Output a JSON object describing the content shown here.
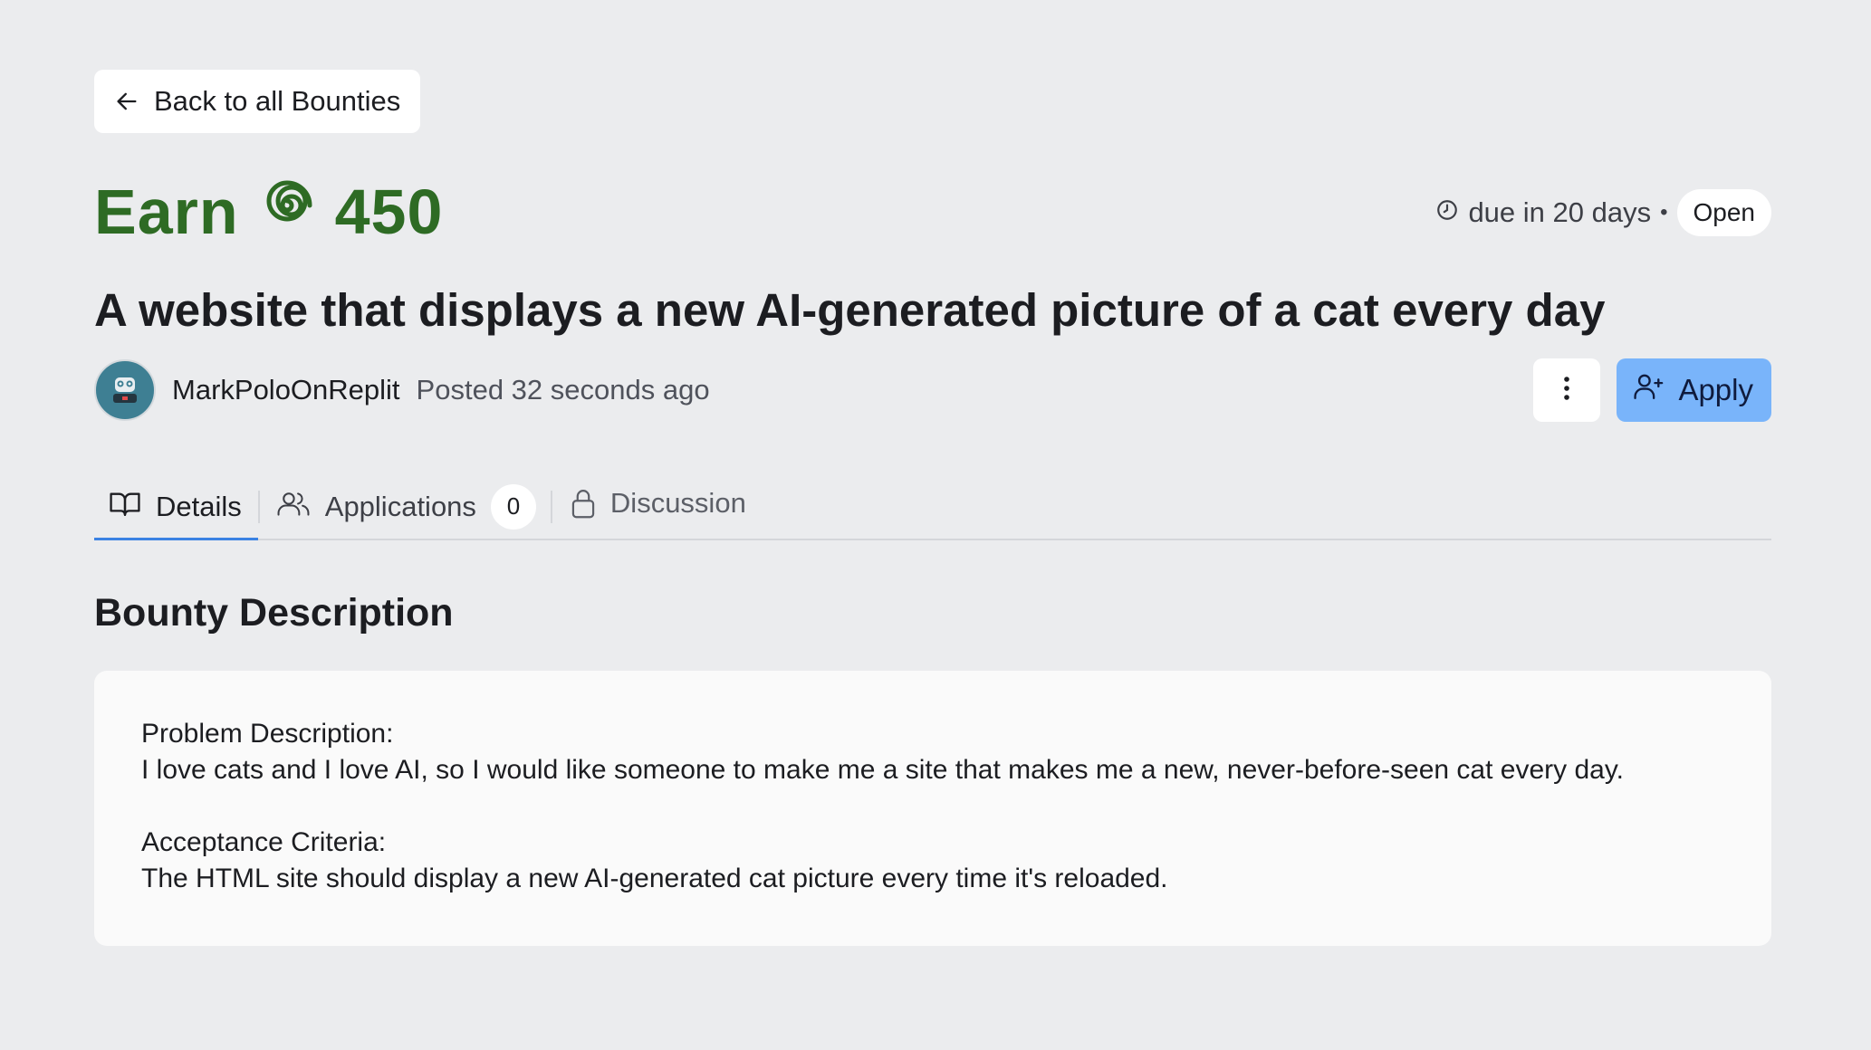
{
  "nav": {
    "back_label": "Back to all Bounties"
  },
  "bounty": {
    "earn_label": "Earn",
    "amount": "450",
    "currency_icon": "cycles-spiral-icon",
    "due_text": "due in 20 days",
    "separator": "•",
    "status": "Open",
    "title": "A website that displays a new AI-generated picture of a cat every day",
    "author": "MarkPoloOnReplit",
    "posted": "Posted 32 seconds ago",
    "apply_label": "Apply"
  },
  "tabs": [
    {
      "label": "Details",
      "icon": "book-icon",
      "active": true
    },
    {
      "label": "Applications",
      "icon": "users-icon",
      "count": "0"
    },
    {
      "label": "Discussion",
      "icon": "lock-icon"
    }
  ],
  "description": {
    "heading": "Bounty Description",
    "problem_heading": "Problem Description:",
    "problem_text": "I love cats and I love AI, so I would like someone to make me a site that makes me a new, never-before-seen cat every day.",
    "criteria_heading": "Acceptance Criteria:",
    "criteria_text": "The HTML site should display a new AI-generated cat picture every time it's reloaded."
  },
  "colors": {
    "background": "#ebecee",
    "earn_green": "#2e6b24",
    "apply_blue": "#79b4fa",
    "tab_underline": "#3b82e3",
    "avatar_bg": "#3e7f93"
  }
}
